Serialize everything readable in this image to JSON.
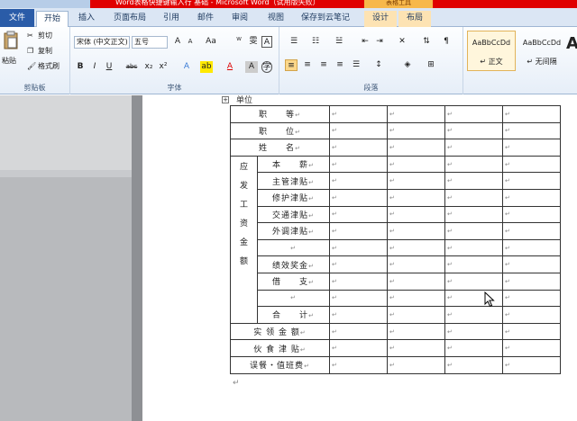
{
  "window": {
    "title": "Word表格快捷键输入行 基础 - Microsoft Word（试用版失败）",
    "context_tab": "表格工具"
  },
  "tabs": [
    "文件",
    "开始",
    "插入",
    "页面布局",
    "引用",
    "邮件",
    "审阅",
    "视图",
    "保存到云笔记",
    "设计",
    "布局"
  ],
  "ribbon": {
    "clipboard": {
      "paste": "粘贴",
      "cut": "剪切",
      "copy": "复制",
      "format_painter": "格式刷",
      "label": "剪贴板"
    },
    "font": {
      "font_name": "宋体 (中文正文)",
      "font_size": "五号",
      "label": "字体"
    },
    "paragraph": {
      "label": "段落"
    },
    "styles": [
      {
        "sample": "AaBbCcDd",
        "name": "↵ 正文"
      },
      {
        "sample": "AaBbCcDd",
        "name": "↵ 无间隔"
      },
      {
        "sample": "A",
        "name": ""
      }
    ]
  },
  "doc": {
    "cutoff_text": "单位",
    "rows": [
      {
        "label": "职　　等"
      },
      {
        "label": "职　　位"
      },
      {
        "label": "姓　　名"
      },
      {
        "label": "本　　薪"
      },
      {
        "label": "主管津贴"
      },
      {
        "label": "修护津贴"
      },
      {
        "label": "交通津贴"
      },
      {
        "label": "外调津贴"
      },
      {
        "label": ""
      },
      {
        "label": "绩效奖金"
      },
      {
        "label": "借　　支"
      },
      {
        "label": ""
      },
      {
        "label": "合　　计"
      },
      {
        "label": "实 领 金 额"
      },
      {
        "label": "伙 食 津 贴"
      },
      {
        "label": "误餐・值班费"
      }
    ],
    "group_label": [
      "应",
      "发",
      "工",
      "资",
      "金",
      "额"
    ],
    "mark": "↵"
  },
  "colors": {
    "title_bar": "#e00000",
    "file_tab": "#2a5ca8",
    "context_tab": "#f7b84b",
    "ribbon": "#e6eef8"
  }
}
